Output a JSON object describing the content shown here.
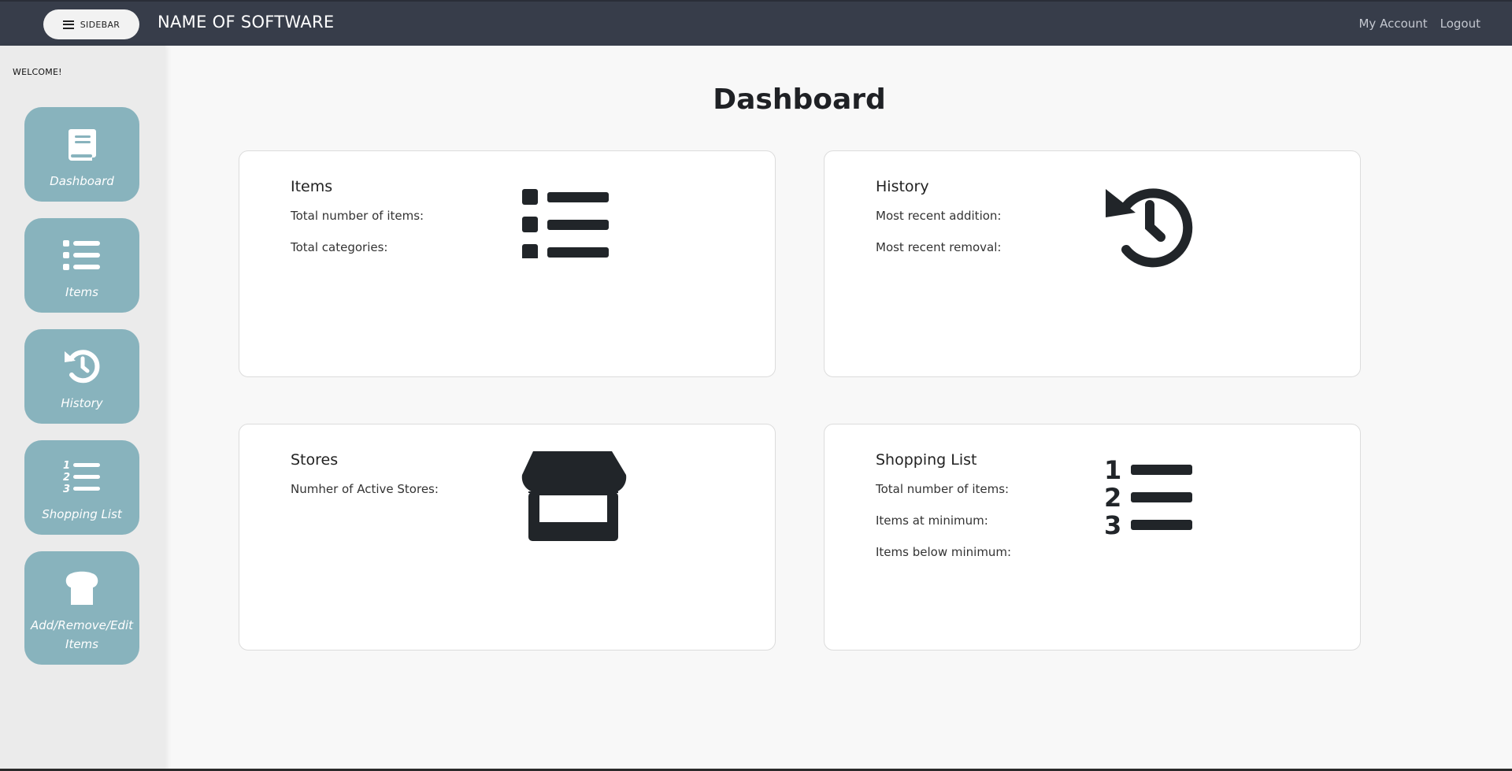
{
  "navbar": {
    "sidebar_button": "SIDEBAR",
    "brand": "NAME OF SOFTWARE",
    "links": [
      "My Account",
      "Logout"
    ]
  },
  "sidebar": {
    "welcome": "WELCOME!",
    "items": [
      {
        "label": "Dashboard",
        "icon": "book-icon"
      },
      {
        "label": "Items",
        "icon": "list-icon"
      },
      {
        "label": "History",
        "icon": "history-icon"
      },
      {
        "label": "Shopping List",
        "icon": "numbered-list-icon"
      },
      {
        "label": "Add/Remove/Edit Items",
        "icon": "bread-icon"
      }
    ]
  },
  "main": {
    "title": "Dashboard",
    "cards": [
      {
        "title": "Items",
        "lines": [
          "Total number of items:",
          "Total categories:"
        ],
        "icon": "list-icon"
      },
      {
        "title": "History",
        "lines": [
          "Most recent addition:",
          "Most recent removal:"
        ],
        "icon": "history-icon"
      },
      {
        "title": "Stores",
        "lines": [
          "Numher of Active Stores:"
        ],
        "icon": "store-icon"
      },
      {
        "title": "Shopping List",
        "lines": [
          "Total number of items:",
          "Items at minimum:",
          "Items below minimum:"
        ],
        "icon": "numbered-list-icon"
      }
    ]
  },
  "colors": {
    "navbar": "#373d4a",
    "sidebar": "#ebebeb",
    "sidebar_button": "#88b3bd",
    "icon_dark": "#212529"
  }
}
